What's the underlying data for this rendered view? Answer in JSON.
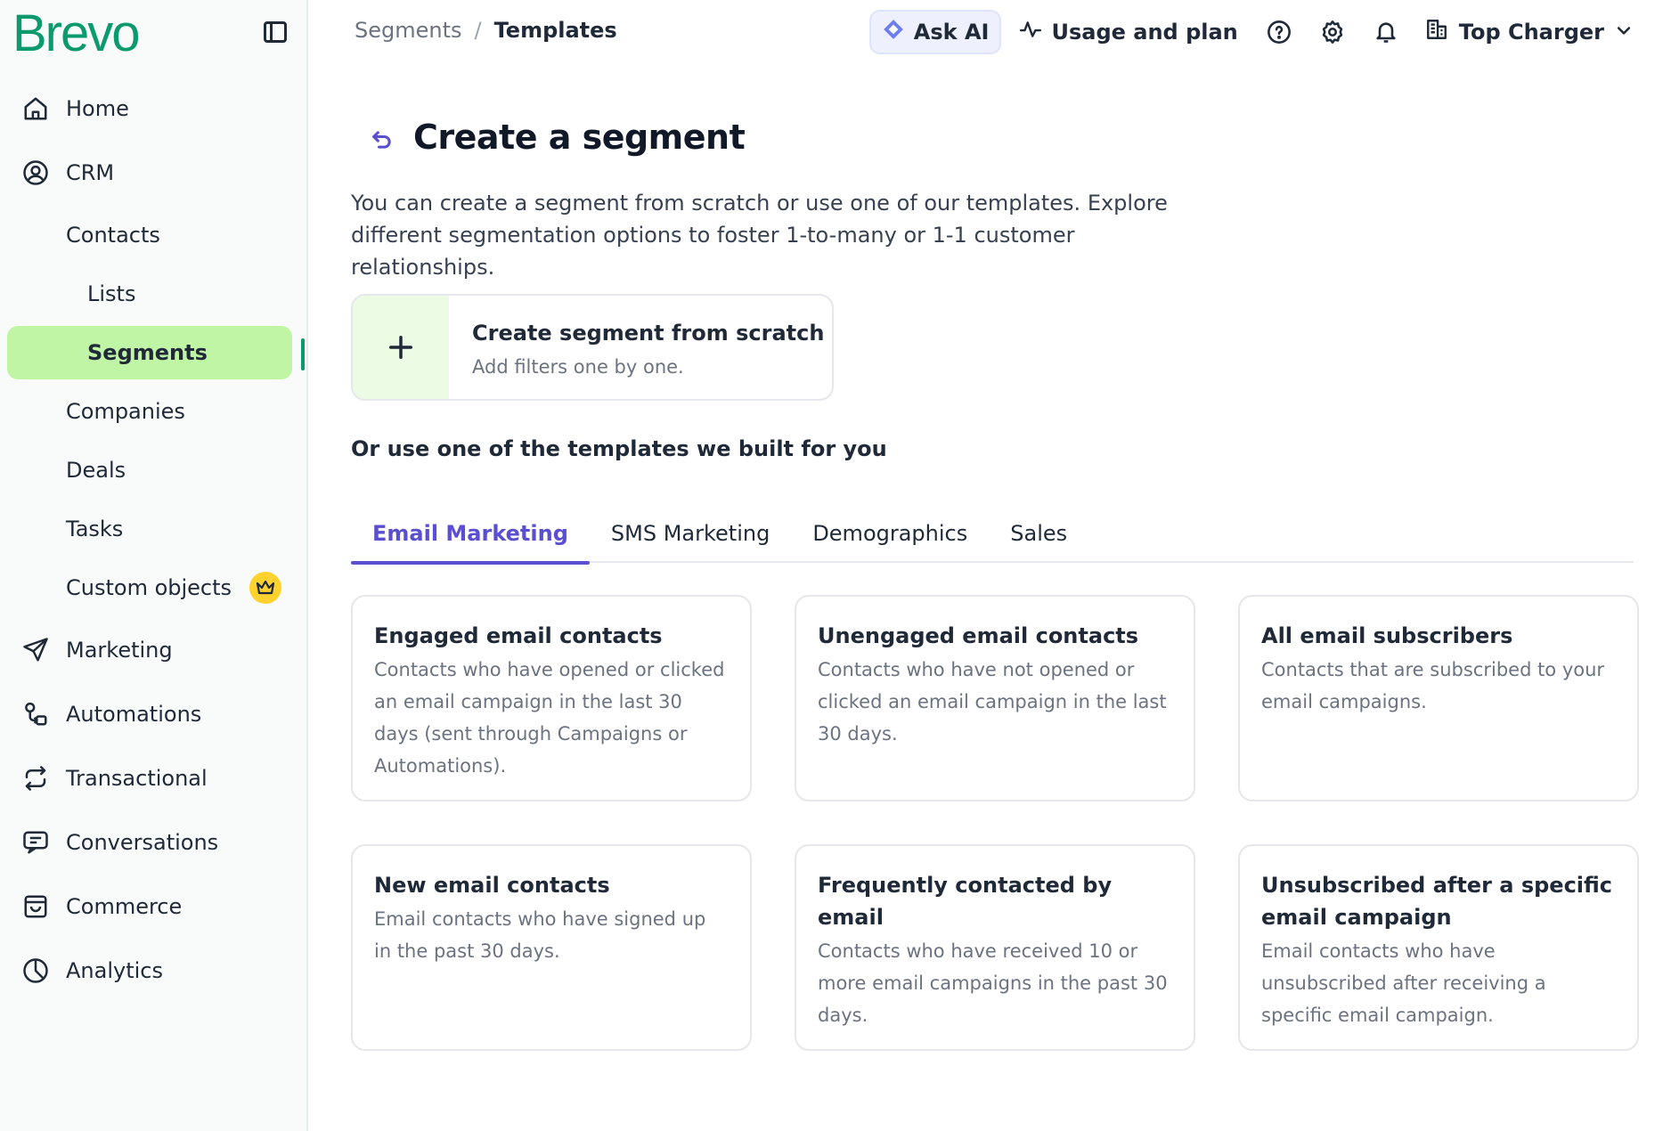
{
  "sidebar": {
    "logo": "Brevo",
    "items": [
      {
        "label": "Home"
      },
      {
        "label": "CRM"
      },
      {
        "label": "Contacts"
      },
      {
        "label": "Lists"
      },
      {
        "label": "Segments"
      },
      {
        "label": "Companies"
      },
      {
        "label": "Deals"
      },
      {
        "label": "Tasks"
      },
      {
        "label": "Custom objects"
      },
      {
        "label": "Marketing"
      },
      {
        "label": "Automations"
      },
      {
        "label": "Transactional"
      },
      {
        "label": "Conversations"
      },
      {
        "label": "Commerce"
      },
      {
        "label": "Analytics"
      }
    ]
  },
  "breadcrumb": {
    "parent": "Segments",
    "separator": "/",
    "current": "Templates"
  },
  "topbar": {
    "ask_ai": "Ask AI",
    "usage": "Usage and plan",
    "account": "Top Charger"
  },
  "page": {
    "title": "Create a segment",
    "description": "You can create a segment from scratch or use one of our templates. Explore different segmentation options to foster 1-to-many or 1-1 customer relationships.",
    "scratch": {
      "title": "Create segment from scratch",
      "subtitle": "Add filters one by one."
    },
    "templates_heading": "Or use one of the templates we built for you"
  },
  "tabs": [
    {
      "label": "Email Marketing"
    },
    {
      "label": "SMS Marketing"
    },
    {
      "label": "Demographics"
    },
    {
      "label": "Sales"
    }
  ],
  "cards": [
    {
      "title": "Engaged email contacts",
      "desc": "Contacts who have opened or clicked an email campaign in the last 30 days (sent through Campaigns or Automations)."
    },
    {
      "title": "Unengaged email contacts",
      "desc": "Contacts who have not opened or clicked an email campaign in the last 30 days."
    },
    {
      "title": "All email subscribers",
      "desc": "Contacts that are subscribed to your email campaigns."
    },
    {
      "title": "New email contacts",
      "desc": "Email contacts who have signed up in the past 30 days."
    },
    {
      "title": "Frequently contacted by email",
      "desc": "Contacts who have received 10 or more email campaigns in the past 30 days."
    },
    {
      "title": "Unsubscribed after a specific email campaign",
      "desc": "Email contacts who have unsubscribed after receiving a specific email campaign."
    }
  ],
  "colors": {
    "brand": "#0b996e",
    "active_nav_bg": "#c0f5a6",
    "accent": "#5b4fd1",
    "badge": "#ffd22e"
  }
}
